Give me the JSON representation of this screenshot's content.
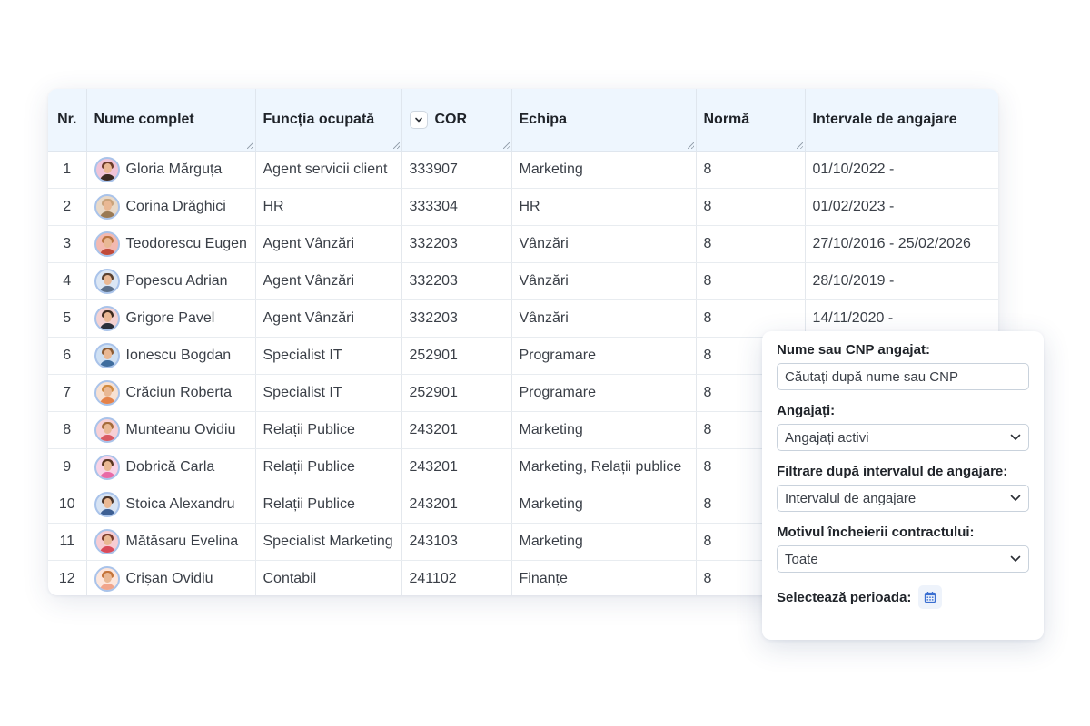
{
  "table": {
    "headers": {
      "nr": "Nr.",
      "name": "Nume complet",
      "role": "Funcția ocupată",
      "cor": "COR",
      "team": "Echipa",
      "norm": "Normă",
      "intervals": "Intervale de angajare"
    },
    "rows": [
      {
        "nr": "1",
        "name": "Gloria Mărguța",
        "role": "Agent servicii client",
        "cor": "333907",
        "team": "Marketing",
        "norm": "8",
        "interval": "01/10/2022 -"
      },
      {
        "nr": "2",
        "name": "Corina Drăghici",
        "role": "HR",
        "cor": "333304",
        "team": "HR",
        "norm": "8",
        "interval": "01/02/2023 -"
      },
      {
        "nr": "3",
        "name": "Teodorescu Eugen",
        "role": "Agent Vânzări",
        "cor": "332203",
        "team": "Vânzări",
        "norm": "8",
        "interval": "27/10/2016 - 25/02/2026"
      },
      {
        "nr": "4",
        "name": "Popescu Adrian",
        "role": "Agent Vânzări",
        "cor": "332203",
        "team": "Vânzări",
        "norm": "8",
        "interval": "28/10/2019 -"
      },
      {
        "nr": "5",
        "name": "Grigore Pavel",
        "role": "Agent Vânzări",
        "cor": "332203",
        "team": "Vânzări",
        "norm": "8",
        "interval": "14/11/2020 -"
      },
      {
        "nr": "6",
        "name": "Ionescu Bogdan",
        "role": "Specialist IT",
        "cor": "252901",
        "team": "Programare",
        "norm": "8",
        "interval": ""
      },
      {
        "nr": "7",
        "name": "Crăciun Roberta",
        "role": "Specialist IT",
        "cor": "252901",
        "team": "Programare",
        "norm": "8",
        "interval": ""
      },
      {
        "nr": "8",
        "name": "Munteanu Ovidiu",
        "role": "Relații Publice",
        "cor": "243201",
        "team": "Marketing",
        "norm": "8",
        "interval": ""
      },
      {
        "nr": "9",
        "name": "Dobrică Carla",
        "role": "Relații Publice",
        "cor": "243201",
        "team": "Marketing, Relații publice",
        "norm": "8",
        "interval": ""
      },
      {
        "nr": "10",
        "name": "Stoica Alexandru",
        "role": "Relații Publice",
        "cor": "243201",
        "team": "Marketing",
        "norm": "8",
        "interval": ""
      },
      {
        "nr": "11",
        "name": "Mătăsaru Evelina",
        "role": "Specialist Marketing",
        "cor": "243103",
        "team": "Marketing",
        "norm": "8",
        "interval": ""
      },
      {
        "nr": "12",
        "name": "Crișan Ovidiu",
        "role": "Contabil",
        "cor": "241102",
        "team": "Finanțe",
        "norm": "8",
        "interval": ""
      }
    ]
  },
  "filters": {
    "search_label": "Nume sau CNP angajat:",
    "search_placeholder": "Căutați după nume sau CNP",
    "employees_label": "Angajați:",
    "employees_value": "Angajați activi",
    "interval_label": "Filtrare după intervalul de angajare:",
    "interval_value": "Intervalul de angajare",
    "reason_label": "Motivul încheierii contractului:",
    "reason_value": "Toate",
    "period_label": "Selectează perioada:"
  },
  "icons": {
    "sort": "chevron-down-icon",
    "select": "chevron-down-icon",
    "calendar": "calendar-icon"
  },
  "colors": {
    "header_bg": "#eef6fe",
    "avatar_ring": "#a9c3ea",
    "calendar_accent": "#3b6fd1"
  }
}
